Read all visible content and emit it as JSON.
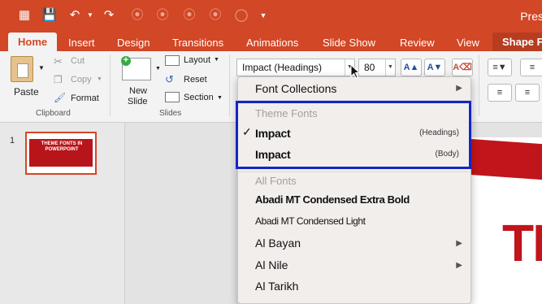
{
  "window": {
    "title": "Pres"
  },
  "tabs": [
    {
      "label": "Home"
    },
    {
      "label": "Insert"
    },
    {
      "label": "Design"
    },
    {
      "label": "Transitions"
    },
    {
      "label": "Animations"
    },
    {
      "label": "Slide Show"
    },
    {
      "label": "Review"
    },
    {
      "label": "View"
    },
    {
      "label": "Shape F"
    }
  ],
  "ribbon": {
    "clipboard": {
      "paste": "Paste",
      "cut": "Cut",
      "copy": "Copy",
      "format": "Format",
      "group": "Clipboard"
    },
    "slides": {
      "new_slide_1": "New",
      "new_slide_2": "Slide",
      "layout": "Layout",
      "reset": "Reset",
      "section": "Section",
      "group": "Slides"
    },
    "font": {
      "name": "Impact (Headings)",
      "size": "80"
    }
  },
  "slide_pane": {
    "number": "1",
    "thumb_text": "THEME FONTS IN POWERPOINT"
  },
  "slide_preview": {
    "big_text": "TH"
  },
  "font_dropdown": {
    "collections_label": "Font Collections",
    "theme_fonts_header": "Theme Fonts",
    "theme_fonts": [
      {
        "name": "Impact",
        "role": "(Headings)",
        "checked": true
      },
      {
        "name": "Impact",
        "role": "(Body)",
        "checked": false
      }
    ],
    "all_fonts_header": "All Fonts",
    "all_fonts": [
      {
        "name": "Abadi MT Condensed Extra Bold"
      },
      {
        "name": "Abadi MT Condensed Light"
      },
      {
        "name": "Al Bayan"
      },
      {
        "name": "Al Nile"
      },
      {
        "name": "Al Tarikh"
      }
    ]
  },
  "colors": {
    "accent": "#d24726",
    "highlight": "#1325c8"
  }
}
